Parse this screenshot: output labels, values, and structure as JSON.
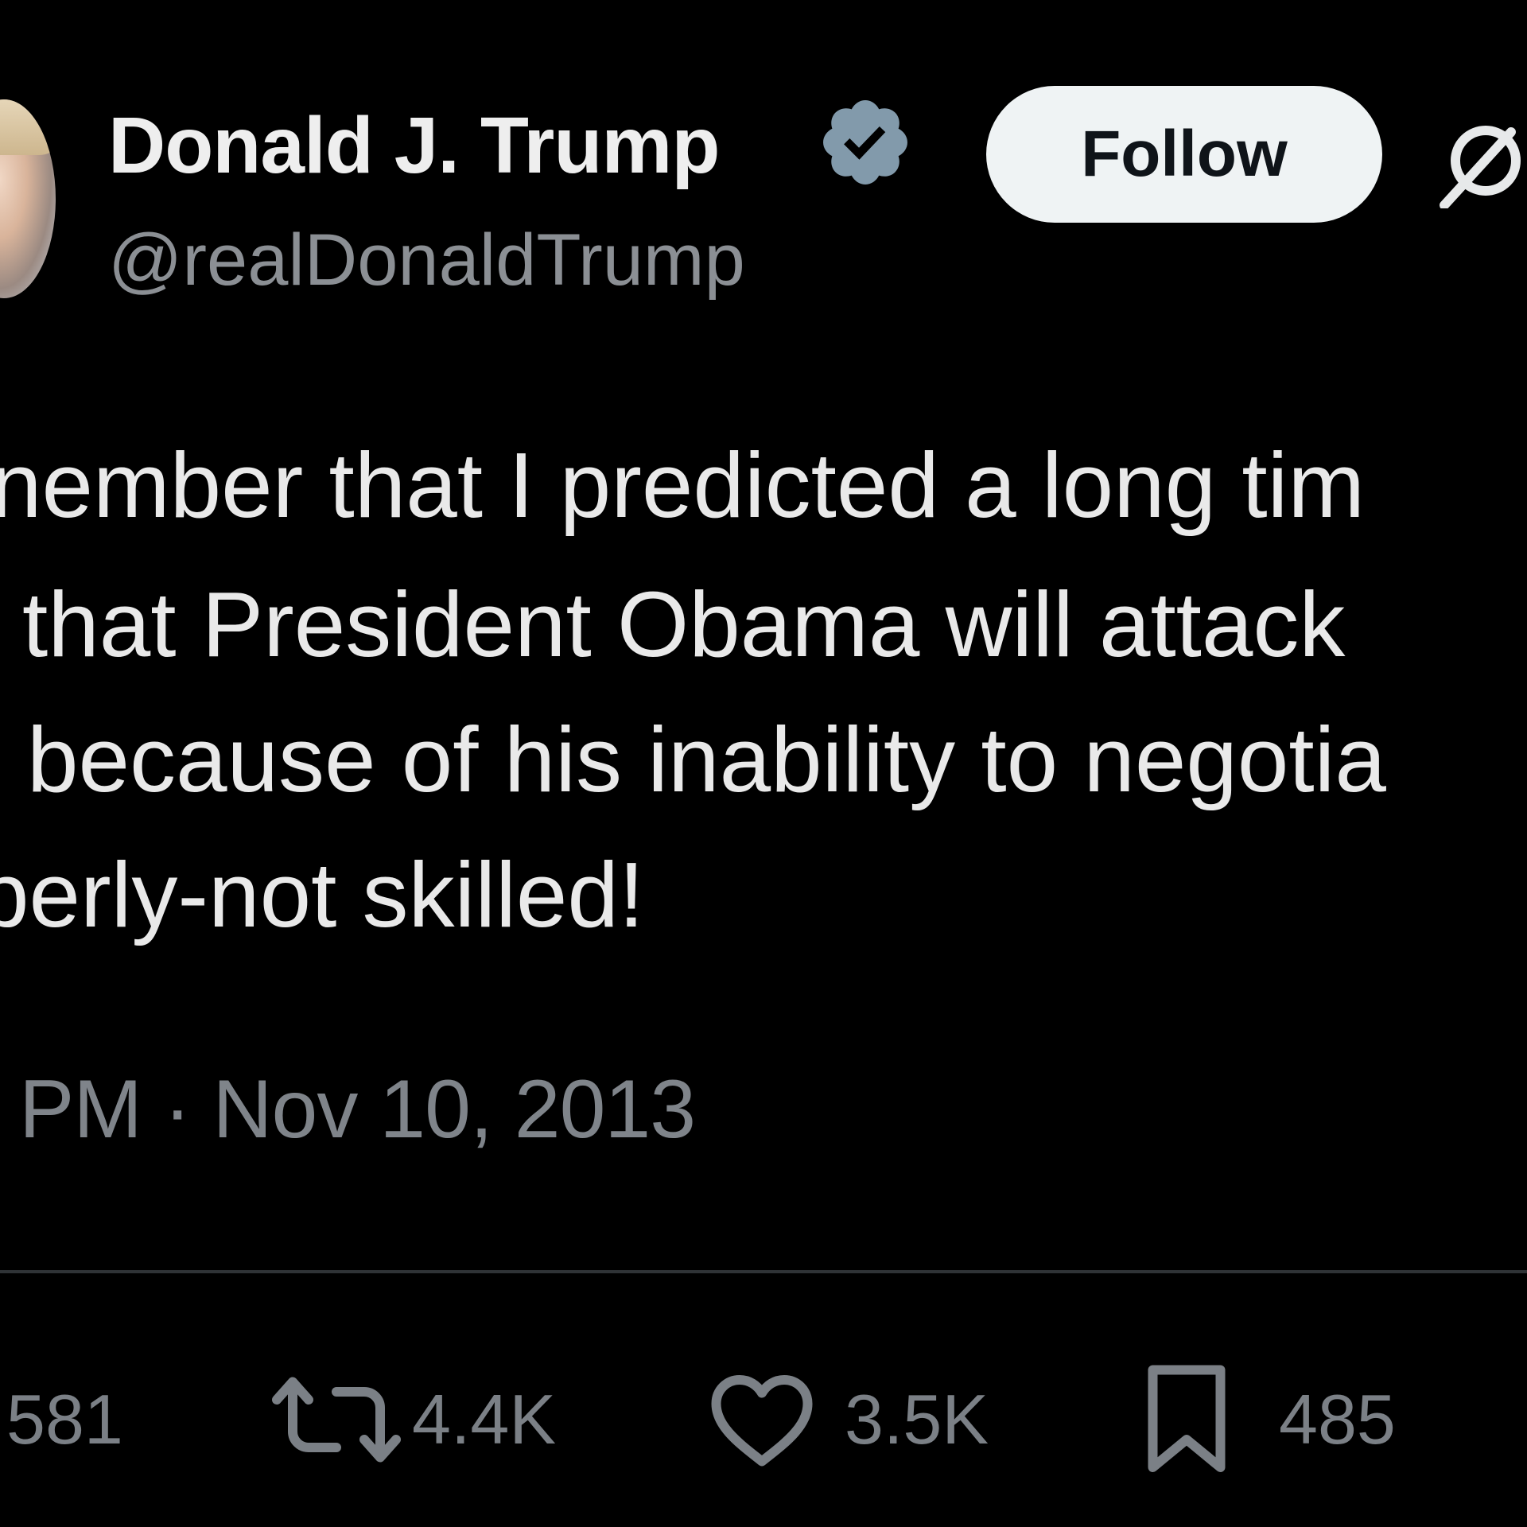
{
  "author": {
    "name": "Donald J. Trump",
    "handle": "@realDonaldTrump",
    "verified": true
  },
  "follow_button": {
    "label": "Follow"
  },
  "icons": {
    "verified": "verified-badge-icon",
    "grok": "grok-icon",
    "reply": "reply-icon",
    "retweet": "retweet-icon",
    "like": "heart-icon",
    "bookmark": "bookmark-icon"
  },
  "tweet": {
    "lines": [
      "nember that I predicted a long tim",
      "that President Obama will attack",
      "because of his inability to negotia",
      "perly-not skilled!"
    ],
    "timestamp": "PM · Nov 10, 2013"
  },
  "stats": {
    "replies": "581",
    "retweets": "4.4K",
    "likes": "3.5K",
    "bookmarks": "485"
  },
  "colors": {
    "background": "#000000",
    "text_primary": "#e7e9ea",
    "text_secondary": "#71767b",
    "verified_badge": "#829aab",
    "divider": "#2f3336",
    "follow_button_bg": "#eff3f4"
  }
}
